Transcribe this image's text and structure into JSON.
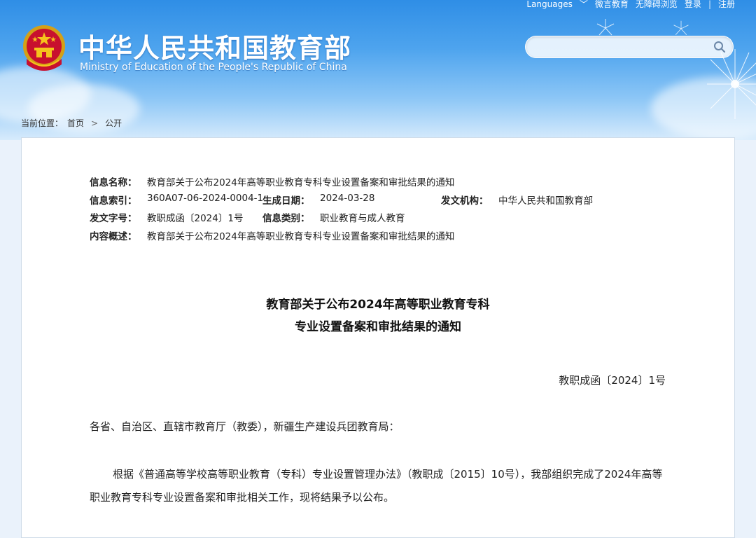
{
  "top_links": {
    "languages": "Languages",
    "weibo": "微言教育",
    "accessible": "无障碍浏览",
    "login": "登录",
    "register": "注册"
  },
  "site": {
    "title_cn": "中华人民共和国教育部",
    "title_en": "Ministry of Education of the People's Republic of China"
  },
  "search": {
    "placeholder": ""
  },
  "breadcrumb": {
    "prefix": "当前位置：",
    "home": "首页",
    "current": "公开"
  },
  "meta": {
    "name_label": "信息名称：",
    "name_value": "教育部关于公布2024年高等职业教育专科专业设置备案和审批结果的通知",
    "index_label": "信息索引：",
    "index_value": "360A07-06-2024-0004-1",
    "date_label": "生成日期：",
    "date_value": "2024-03-28",
    "issuer_label": "发文机构：",
    "issuer_value": "中华人民共和国教育部",
    "docno_label": "发文字号：",
    "docno_value": "教职成函〔2024〕1号",
    "category_label": "信息类别：",
    "category_value": "职业教育与成人教育",
    "summary_label": "内容概述：",
    "summary_value": "教育部关于公布2024年高等职业教育专科专业设置备案和审批结果的通知"
  },
  "document": {
    "title_line1": "教育部关于公布2024年高等职业教育专科",
    "title_line2": "专业设置备案和审批结果的通知",
    "doc_number": "教职成函〔2024〕1号",
    "addressee": "各省、自治区、直辖市教育厅（教委），新疆生产建设兵团教育局：",
    "paragraph1": "根据《普通高等学校高等职业教育（专科）专业设置管理办法》（教职成〔2015〕10号），我部组织完成了2024年高等职业教育专科专业设置备案和审批相关工作，现将结果予以公布。"
  },
  "colors": {
    "header_blue": "#2f8ee6",
    "panel_border": "#cfdbe8"
  }
}
